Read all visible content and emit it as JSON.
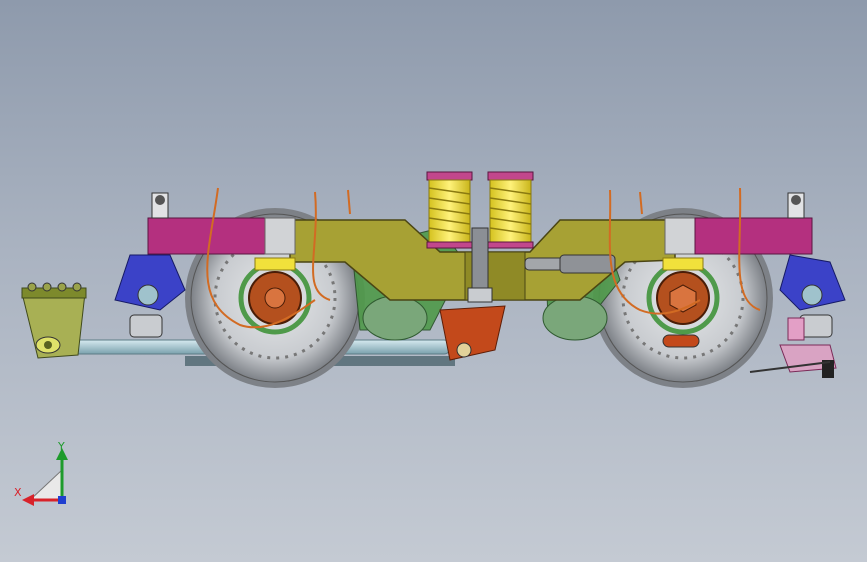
{
  "viewport": {
    "background_top": "#8e9aac",
    "background_bottom": "#c4cad3",
    "model": "bogie-side-view"
  },
  "triad": {
    "x_label": "X",
    "y_label": "Y",
    "x_color": "#d8222a",
    "y_color": "#1e9b2c",
    "z_color": "#1f3fd0"
  },
  "colors": {
    "frame_olive": "#a7a134",
    "end_magenta": "#b4307f",
    "spring_yellow": "#f1e13b",
    "spring_pink": "#c2478c",
    "wheel_grey": "#c9ccd0",
    "axlebox_brown": "#b4501e",
    "bracket_blue": "#3b42c8",
    "green_part": "#4f9a4a",
    "bar_light": "#9fc2cc",
    "orange_block": "#c3491b"
  }
}
